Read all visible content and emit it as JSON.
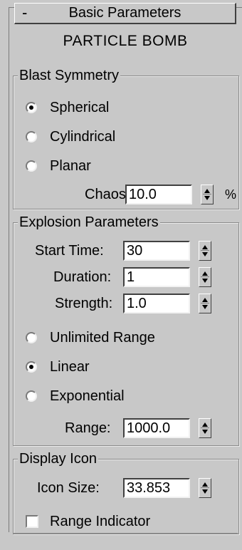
{
  "rollout": {
    "collapse_symbol": "-",
    "title": "Basic Parameters",
    "subtitle": "PARTICLE BOMB"
  },
  "blast_symmetry": {
    "legend": "Blast Symmetry",
    "options": [
      {
        "label": "Spherical",
        "selected": true
      },
      {
        "label": "Cylindrical",
        "selected": false
      },
      {
        "label": "Planar",
        "selected": false
      }
    ],
    "chaos": {
      "label": "Chaos:",
      "value": "10.0",
      "unit": "%"
    }
  },
  "explosion_parameters": {
    "legend": "Explosion Parameters",
    "start_time": {
      "label": "Start Time:",
      "value": "30"
    },
    "duration": {
      "label": "Duration:",
      "value": "1"
    },
    "strength": {
      "label": "Strength:",
      "value": "1.0"
    },
    "range_options": [
      {
        "label": "Unlimited Range",
        "selected": false
      },
      {
        "label": "Linear",
        "selected": true
      },
      {
        "label": "Exponential",
        "selected": false
      }
    ],
    "range": {
      "label": "Range:",
      "value": "1000.0"
    }
  },
  "display_icon": {
    "legend": "Display Icon",
    "icon_size": {
      "label": "Icon Size:",
      "value": "33.853"
    },
    "range_indicator": {
      "label": "Range Indicator",
      "checked": false
    }
  }
}
